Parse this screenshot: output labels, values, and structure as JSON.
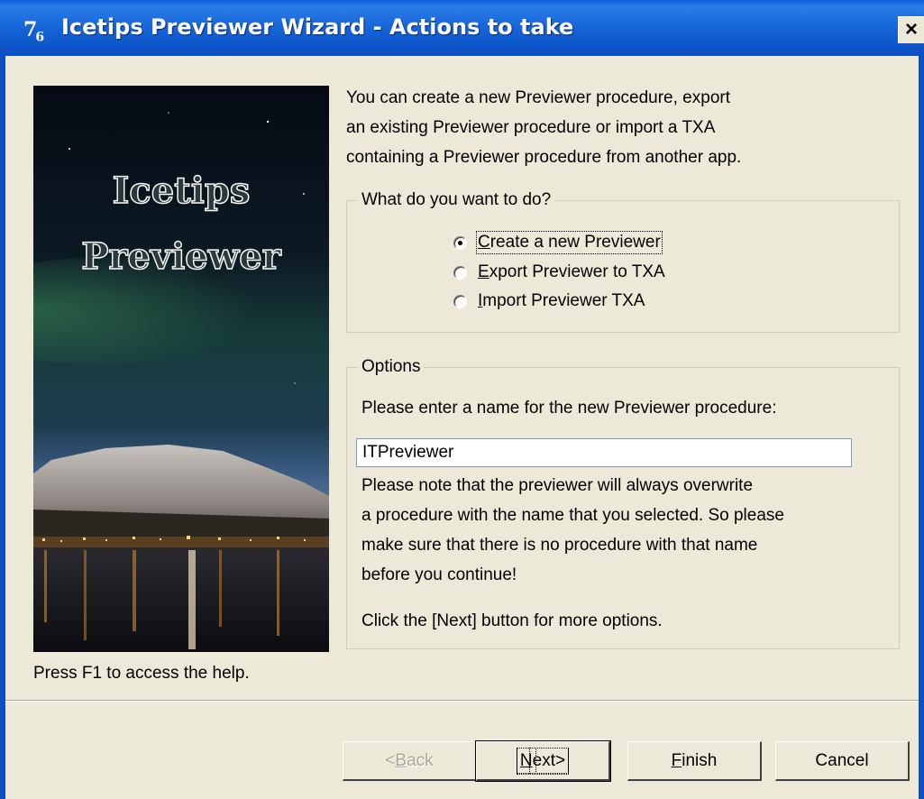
{
  "window": {
    "title": "Icetips Previewer Wizard - Actions to take",
    "icon_label": "7",
    "icon_sub": "6",
    "close_label": "×"
  },
  "side_image": {
    "line1": "Icetips",
    "line2": "Previewer"
  },
  "intro": {
    "lines": [
      "You can create a new Previewer procedure, export",
      "an existing Previewer procedure or import a TXA",
      "containing a Previewer procedure from another app."
    ]
  },
  "action_group": {
    "legend": "What do you want to do?",
    "options": [
      {
        "pre": "",
        "key": "C",
        "post": "reate a new Previewer",
        "checked": true
      },
      {
        "pre": "",
        "key": "E",
        "post": "xport Previewer to TXA",
        "checked": false
      },
      {
        "pre": "",
        "key": "I",
        "post": "mport Previewer TXA",
        "checked": false
      }
    ]
  },
  "options_group": {
    "legend": "Options",
    "prompt": "Please enter a name for the new Previewer procedure:",
    "name_value": "ITPreviewer",
    "note_lines": [
      "Please note that the previewer will always overwrite",
      "a procedure with the name that you selected.  So please",
      "make sure that there is no procedure with that name",
      "before you continue!"
    ],
    "next_hint": "Click the [Next] button for more options."
  },
  "help_text": "Press F1 to access the help.",
  "buttons": {
    "back": {
      "pre": "<",
      "key": "B",
      "post": "ack"
    },
    "next": {
      "pre": "",
      "key": "N",
      "post": "ext>"
    },
    "finish": {
      "pre": "",
      "key": "F",
      "post": "inish"
    },
    "cancel": {
      "pre": "",
      "key": "",
      "post": "Cancel"
    }
  }
}
